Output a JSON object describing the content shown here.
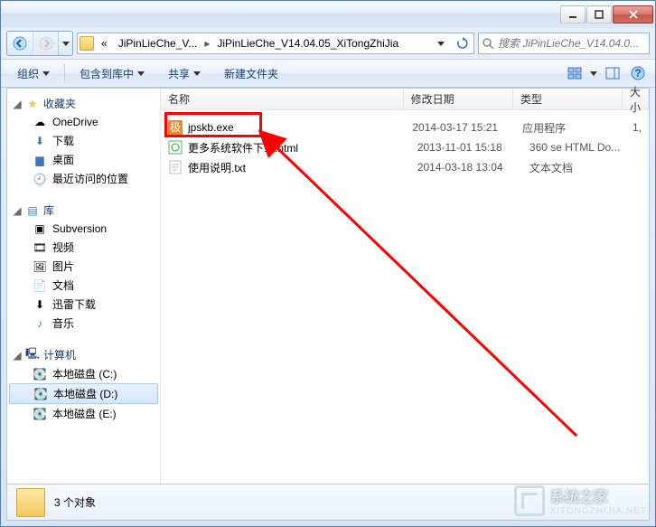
{
  "breadcrumb": {
    "prefix": "«",
    "seg1": "JiPinLieChe_V...",
    "seg2": "JiPinLieChe_V14.04.05_XiTongZhiJia"
  },
  "search": {
    "placeholder": "搜索 JiPinLieChe_V14.04.0..."
  },
  "toolbar": {
    "organize": "组织",
    "include": "包含到库中",
    "share": "共享",
    "newFolder": "新建文件夹"
  },
  "nav": {
    "favorites": {
      "label": "收藏夹",
      "items": [
        "OneDrive",
        "下载",
        "桌面",
        "最近访问的位置"
      ]
    },
    "libraries": {
      "label": "库",
      "items": [
        "Subversion",
        "视频",
        "图片",
        "文档",
        "迅雷下载",
        "音乐"
      ]
    },
    "computer": {
      "label": "计算机",
      "items": [
        "本地磁盘 (C:)",
        "本地磁盘 (D:)",
        "本地磁盘 (E:)"
      ],
      "selectedIndex": 1
    }
  },
  "columns": {
    "name": "名称",
    "date": "修改日期",
    "type": "类型",
    "size": "大小"
  },
  "files": [
    {
      "icon": "exe",
      "name": "jpskb.exe",
      "date": "2014-03-17 15:21",
      "type": "应用程序",
      "size": "1,"
    },
    {
      "icon": "html",
      "name": "更多系统软件下载.html",
      "date": "2013-11-01 15:18",
      "type": "360 se HTML Do...",
      "size": ""
    },
    {
      "icon": "txt",
      "name": "使用说明.txt",
      "date": "2014-03-18 13:04",
      "type": "文本文档",
      "size": ""
    }
  ],
  "status": {
    "count": "3 个对象"
  },
  "watermark": {
    "title": "系统之家",
    "sub": "XITONGZHIJIA.NET"
  }
}
